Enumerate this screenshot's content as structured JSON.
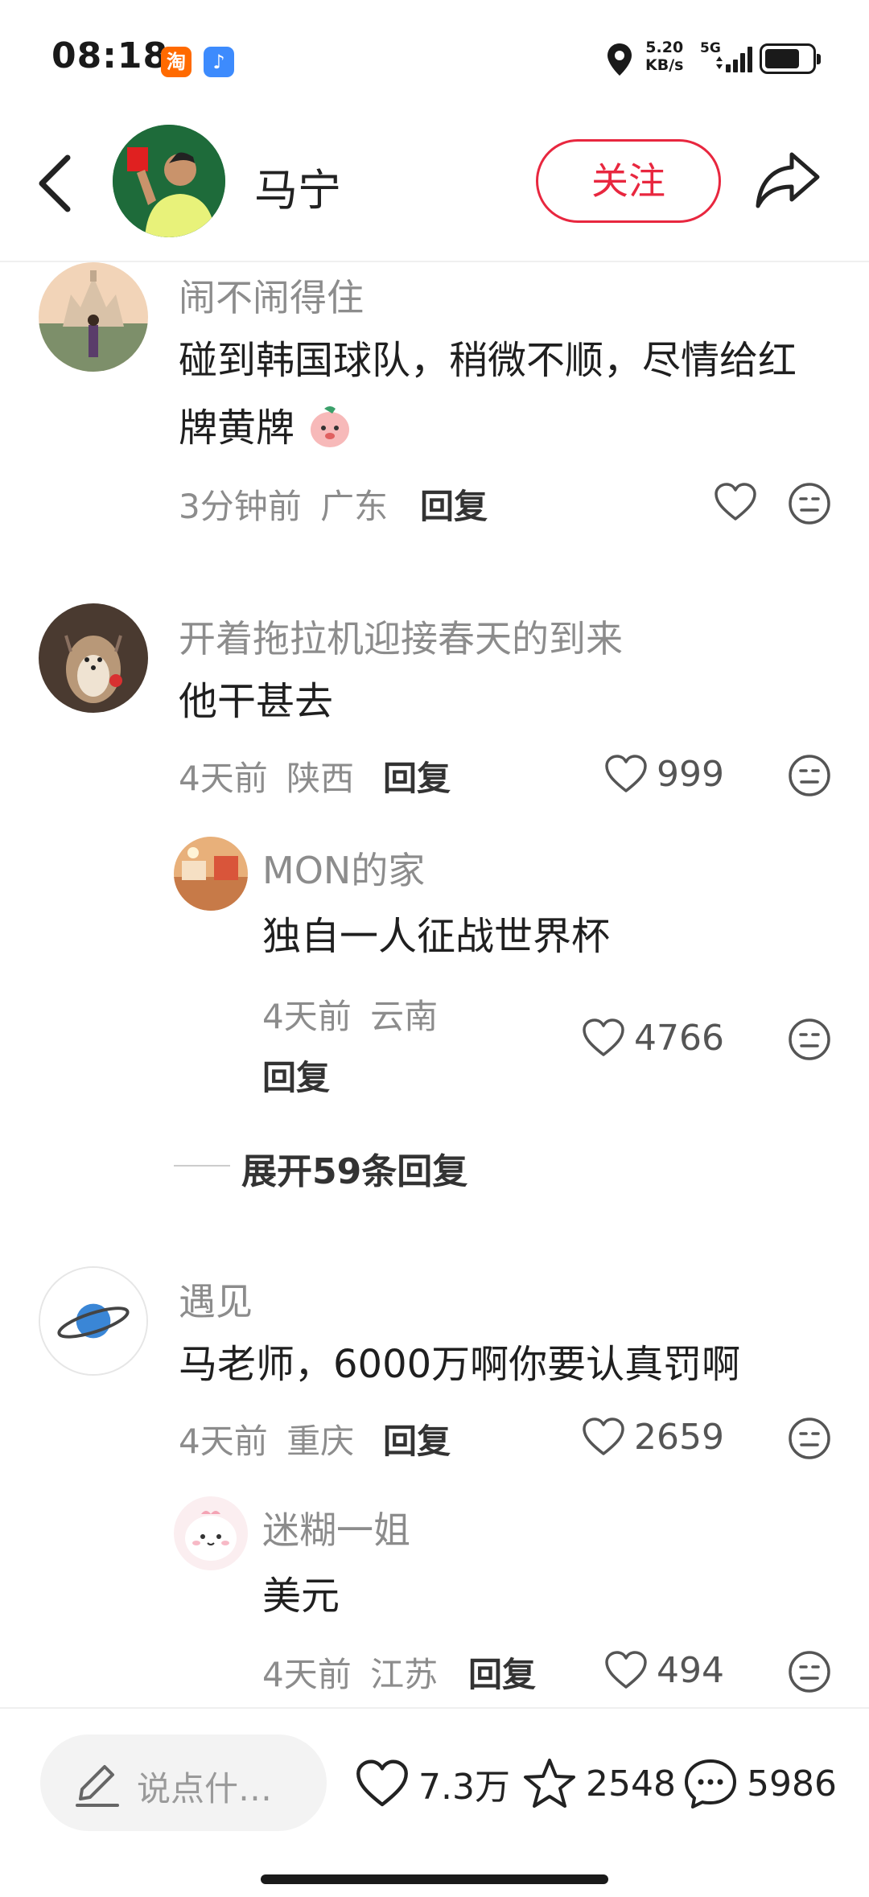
{
  "status_bar": {
    "time": "08:18",
    "app_icon_1": "淘",
    "app_icon_2": "♪",
    "speed_value": "5.20",
    "speed_unit": "KB/s",
    "network": "5G"
  },
  "header": {
    "user_name": "马宁",
    "follow_label": "关注"
  },
  "comments": [
    {
      "name": "闹不闹得住",
      "text": "碰到韩国球队，稍微不顺，尽情给红牌黄牌",
      "time": "3分钟前",
      "location": "广东",
      "reply_label": "回复",
      "likes": ""
    },
    {
      "name": "开着拖拉机迎接春天的到来",
      "text": "他干甚去",
      "time": "4天前",
      "location": "陕西",
      "reply_label": "回复",
      "likes": "999",
      "replies": [
        {
          "name": "MON的家",
          "text": "独自一人征战世界杯",
          "time": "4天前",
          "location": "云南",
          "reply_label": "回复",
          "likes": "4766"
        }
      ],
      "expand_label": "展开59条回复"
    },
    {
      "name": "遇见",
      "text": "马老师，6000万啊你要认真罚啊",
      "time": "4天前",
      "location": "重庆",
      "reply_label": "回复",
      "likes": "2659",
      "replies": [
        {
          "name": "迷糊一姐",
          "text": "美元",
          "time": "4天前",
          "location": "江苏",
          "reply_label": "回复",
          "likes": "494"
        }
      ]
    }
  ],
  "bottom_bar": {
    "input_placeholder": "说点什…",
    "like_count": "7.3万",
    "favorite_count": "2548",
    "comment_count": "5986"
  },
  "colors": {
    "accent": "#e8273f",
    "meta_text": "#8c8c8c"
  }
}
